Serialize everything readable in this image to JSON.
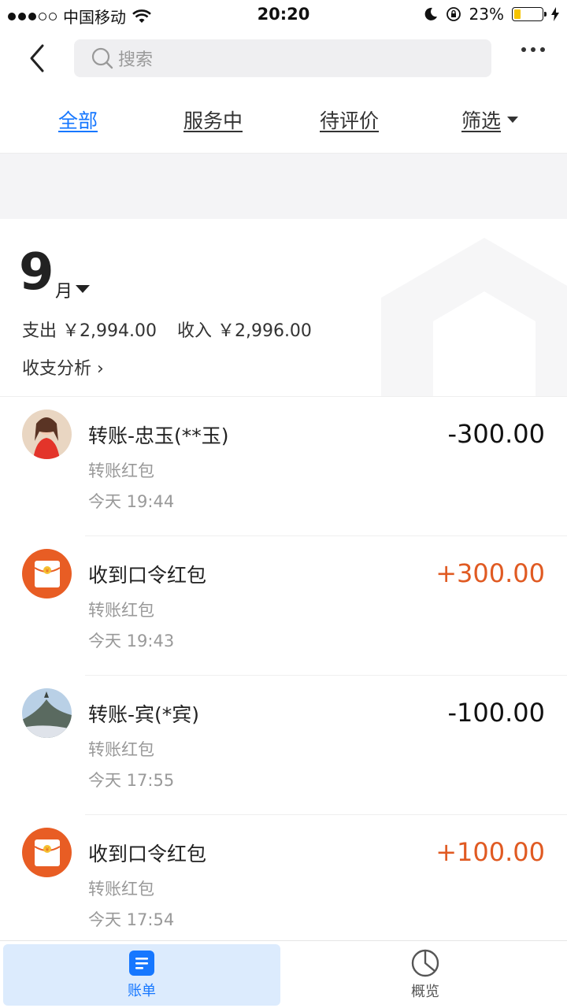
{
  "status_bar": {
    "carrier": "中国移动",
    "time": "20:20",
    "battery": "23%",
    "battery_level": 0.23
  },
  "nav": {
    "search_placeholder": "搜索"
  },
  "tabs": [
    {
      "label": "全部"
    },
    {
      "label": "服务中"
    },
    {
      "label": "待评价"
    },
    {
      "label": "筛选"
    }
  ],
  "month": {
    "number": "9",
    "unit": "月",
    "expense": "支出 ￥2,994.00",
    "income": "收入 ￥2,996.00",
    "analysis": "收支分析 ›"
  },
  "transactions": [
    {
      "title": "转账-忠玉(**玉)",
      "category": "转账红包",
      "time": "今天  19:44",
      "amount": "-300.00",
      "direction": "out"
    },
    {
      "title": "收到口令红包",
      "category": "转账红包",
      "time": "今天  19:43",
      "amount": "+300.00",
      "direction": "in"
    },
    {
      "title": "转账-宾(*宾)",
      "category": "转账红包",
      "time": "今天  17:55",
      "amount": "-100.00",
      "direction": "out"
    },
    {
      "title": "收到口令红包",
      "category": "转账红包",
      "time": "今天  17:54",
      "amount": "+100.00",
      "direction": "in"
    }
  ],
  "bottom_tabs": [
    {
      "label": "账单",
      "icon": "bill-icon"
    },
    {
      "label": "概览",
      "icon": "pie-chart-icon"
    }
  ],
  "colors": {
    "accent": "#1677ff",
    "income": "#e05a22",
    "red_packet": "#e85d24"
  }
}
